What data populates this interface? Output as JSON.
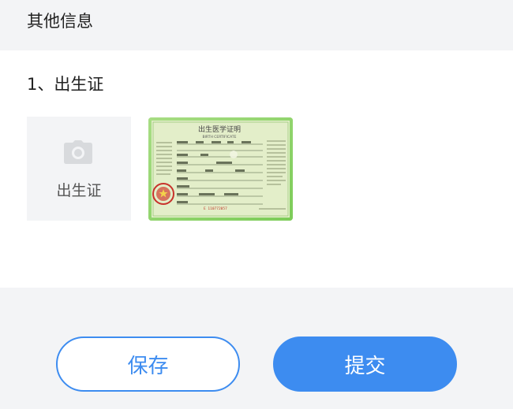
{
  "section": {
    "title": "其他信息"
  },
  "item": {
    "title": "1、出生证",
    "upload_label": "出生证",
    "upload_icon": "camera-icon",
    "thumbnail": {
      "heading": "出生医学证明",
      "subheading": "BIRTH CERTIFICATE",
      "serial": "E 110772057"
    }
  },
  "footer": {
    "save_label": "保存",
    "submit_label": "提交"
  },
  "colors": {
    "accent": "#3d8cf0",
    "page_bg": "#f3f4f6",
    "certificate_green": "#8ed36b"
  }
}
